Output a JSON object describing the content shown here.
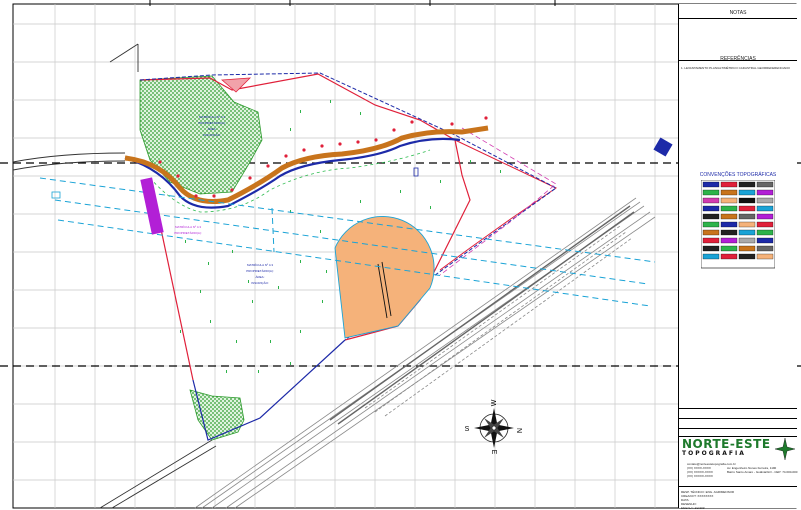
{
  "drawing": {
    "parcel_label_top": [
      "MATRÍCULA Nº 4.3",
      "PROPRIETÁRIO(A): ",
      "ÁREA: ",
      "INSCRIÇÃO: "
    ],
    "parcel_label_center": [
      "MATRÍCULA Nº 4.3",
      "PROPRIETÁRIO(A):",
      "ÁREA: ",
      "INSCRIÇÃO: "
    ],
    "parcel_label_left": [
      "MATRÍCULA Nº 4.3",
      "PROPRIETÁRIO(A): "
    ],
    "compass": {
      "north": "N",
      "south": "S",
      "east": "E",
      "west": "W"
    }
  },
  "panel": {
    "notes_title": "NOTAS",
    "references_title": "REFERÊNCIAS",
    "references_text": "1. LEVANTAMENTO PLANIALTIMÉTRICO CADASTRAL GEORREFERENCIADO",
    "conventions_title": "CONVENÇÕES TOPOGRÁFICAS",
    "company_name": "NORTE-ESTE",
    "company_sub": "TOPOGRAFIA",
    "contact_lines": [
      "contato@norteestetopografia.com.br",
      "(XX) XXXX-XXXX",
      "(XX) XXXXX-XXXX",
      "(XX) XXXXX-XXXX"
    ],
    "address_lines": [
      "Av. Engenheiro Nunes Ferreira, 1190",
      "Bairro Santo Amaro - Goiânia/GO - CEP: 74.000-000"
    ],
    "footer_lines": [
      "RESP. TÉCNICO: ENG. AGRIMENSOR",
      "CREA/CFT: XXXXXXXX",
      "DATA:",
      "DESENHO: ",
      "ESCALA: 1/2.000"
    ]
  },
  "colors": {
    "green_area": "#3aa53a",
    "boundary_red": "#e0203a",
    "road_brown": "#c8741c",
    "road_blue": "#1d2aa8",
    "dashed_cyan": "#1aa3d6",
    "orange_circle": "#f5b27a",
    "highway_gray": "#8a8a8a"
  }
}
